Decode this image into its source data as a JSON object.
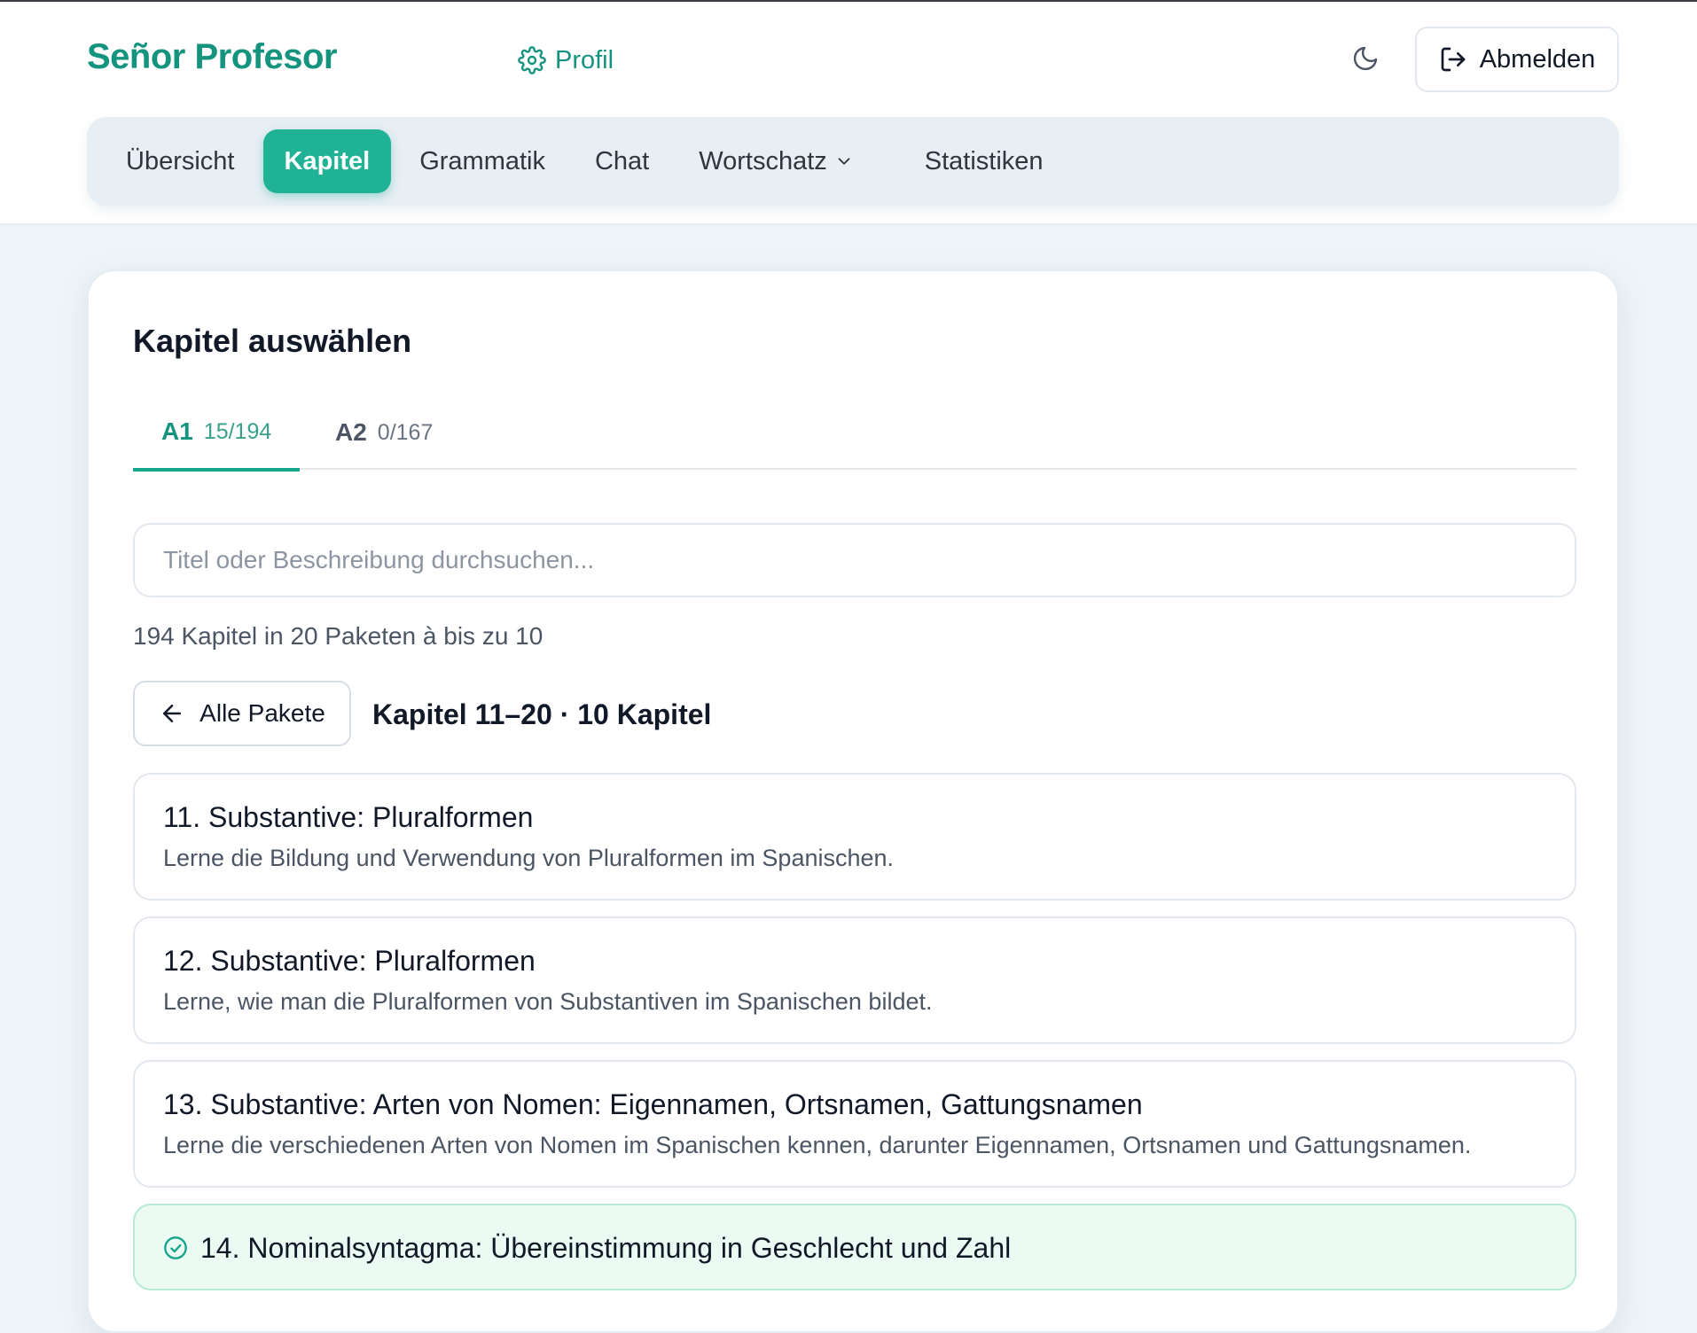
{
  "header": {
    "brand": "Señor Profesor",
    "profile_label": "Profil",
    "logout_label": "Abmelden"
  },
  "nav": {
    "items": [
      {
        "label": "Übersicht"
      },
      {
        "label": "Kapitel",
        "active": true
      },
      {
        "label": "Grammatik"
      },
      {
        "label": "Chat"
      },
      {
        "label": "Wortschatz",
        "has_dropdown": true
      },
      {
        "label": "Statistiken"
      }
    ]
  },
  "main": {
    "title": "Kapitel auswählen",
    "tabs": [
      {
        "level": "A1",
        "count": "15/194",
        "active": true
      },
      {
        "level": "A2",
        "count": "0/167",
        "active": false
      }
    ],
    "search_placeholder": "Titel oder Beschreibung durchsuchen...",
    "summary": "194 Kapitel in 20 Paketen à bis zu 10",
    "back_label": "Alle Pakete",
    "pack_title": "Kapitel 11–20 · 10 Kapitel",
    "chapters": [
      {
        "title": "11. Substantive: Pluralformen",
        "description": "Lerne die Bildung und Verwendung von Pluralformen im Spanischen.",
        "completed": false
      },
      {
        "title": "12. Substantive: Pluralformen",
        "description": "Lerne, wie man die Pluralformen von Substantiven im Spanischen bildet.",
        "completed": false
      },
      {
        "title": "13. Substantive: Arten von Nomen: Eigennamen, Ortsnamen, Gattungsnamen",
        "description": "Lerne die verschiedenen Arten von Nomen im Spanischen kennen, darunter Eigennamen, Ortsnamen und Gattungsnamen.",
        "completed": false
      },
      {
        "title": "14. Nominalsyntagma: Übereinstimmung in Geschlecht und Zahl",
        "description": "",
        "completed": true
      }
    ]
  },
  "colors": {
    "accent": "#1fb295",
    "brand_text": "#14947f",
    "completed_bg": "#ecfaf4"
  },
  "icons": {
    "profile": "gear-icon",
    "theme": "moon-icon",
    "logout": "logout-icon",
    "back": "arrow-left-icon",
    "dropdown": "chevron-down-icon",
    "completed": "check-circle-icon"
  }
}
